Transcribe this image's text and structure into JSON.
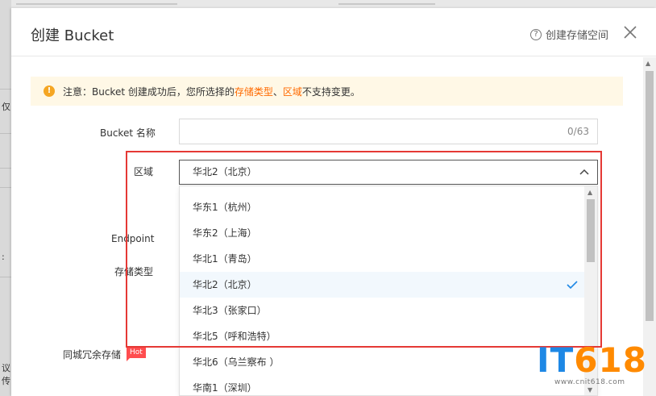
{
  "backdrop": {
    "frag1": "仅",
    "frag2": ":",
    "frag3": "议",
    "frag4": "传"
  },
  "dialog": {
    "title": "创建 Bucket",
    "help_label": "创建存储空间",
    "alert": {
      "prefix": "注意：Bucket 创建成功后，您所选择的 ",
      "hl1": "存储类型",
      "sep": "、",
      "hl2": "区域",
      "suffix": " 不支持变更。"
    },
    "labels": {
      "bucket_name": "Bucket 名称",
      "region": "区域",
      "endpoint": "Endpoint",
      "storage_type": "存储类型",
      "redundancy": "同城冗余存储"
    },
    "bucket_name": {
      "value": "",
      "counter": "0/63"
    },
    "region": {
      "selected": "华北2（北京）",
      "options": [
        "华东1（杭州）",
        "华东2（上海）",
        "华北1（青岛）",
        "华北2（北京）",
        "华北3（张家口）",
        "华北5（呼和浩特）",
        "华北6（乌兰察布 ）",
        "华南1（深圳）"
      ],
      "selected_index": 3
    },
    "hot_badge": "Hot"
  },
  "watermark": {
    "it": "IT",
    "num": "618",
    "url": "www.cnit618.com"
  },
  "colors": {
    "accent": "#ff6a00",
    "highlight_box": "#e53935",
    "selected_row": "#f2f8fd",
    "check": "#1e88e5"
  }
}
